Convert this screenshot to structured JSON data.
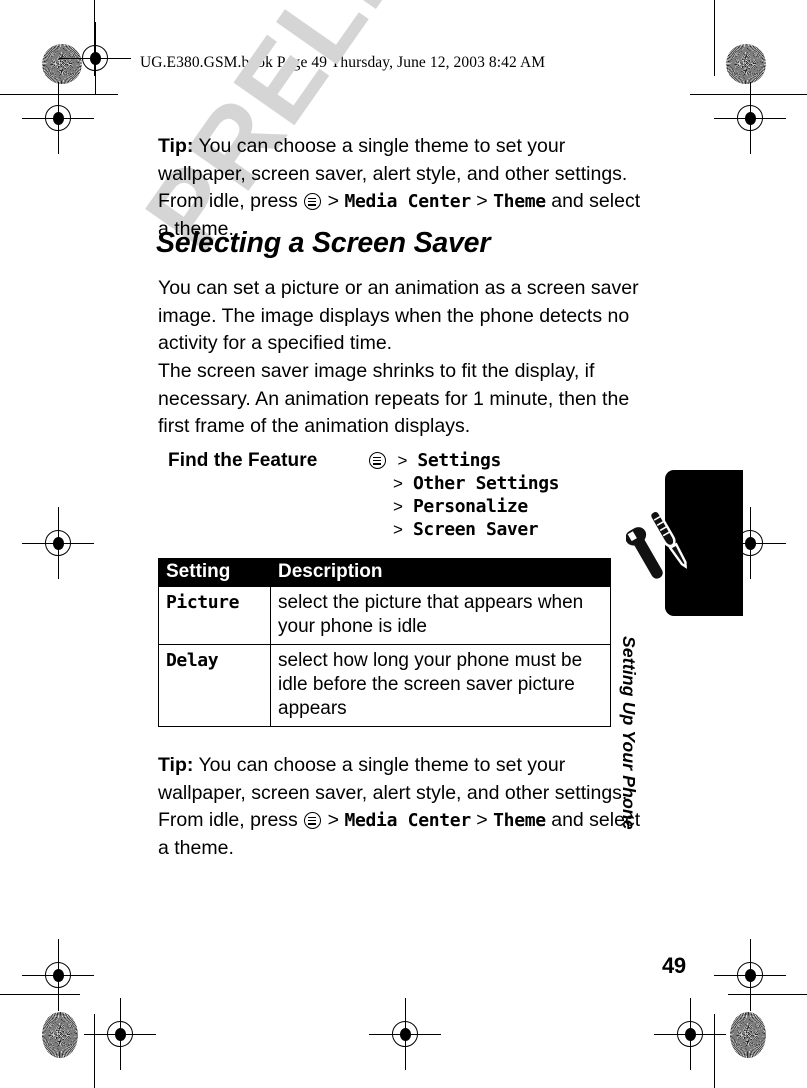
{
  "header": {
    "slug": "UG.E380.GSM.book  Page 49  Thursday, June 12, 2003  8:42 AM"
  },
  "watermark": {
    "text": "PRELIMINARY"
  },
  "main": {
    "tip_top": {
      "label": "Tip:",
      "text_1": " You can choose a single theme to set your wallpaper, screen saver, alert style, and other settings. From idle, press ",
      "menu_icon": "menu-icon",
      "sep_1": " > ",
      "menu_1": "Media Center",
      "sep_2": " > ",
      "menu_2": "Theme",
      "text_2": " and select a theme."
    },
    "heading": "Selecting a Screen Saver",
    "paragraph_1": "You can set a picture or an animation as a screen saver image. The image displays when the phone detects no activity for a specified time.",
    "paragraph_2": "The screen saver image shrinks to fit the display, if necessary. An animation repeats for 1 minute, then the first frame of the animation displays.",
    "find_the_feature": {
      "label": "Find the Feature",
      "menu_icon": "menu-icon",
      "steps": [
        {
          "sep": ">",
          "label": "Settings"
        },
        {
          "sep": ">",
          "label": "Other Settings"
        },
        {
          "sep": ">",
          "label": "Personalize"
        },
        {
          "sep": ">",
          "label": "Screen Saver"
        }
      ]
    },
    "table": {
      "headers": [
        "Setting",
        "Description"
      ],
      "rows": [
        {
          "setting": "Picture",
          "description": "select the picture that appears when your phone is idle"
        },
        {
          "setting": "Delay",
          "description": "select how long your phone must be idle before the screen saver picture appears"
        }
      ]
    },
    "tip_bottom": {
      "label": "Tip:",
      "text_1": " You can choose a single theme to set your wallpaper, screen saver, alert style, and other settings. From idle, press ",
      "menu_icon": "menu-icon",
      "sep_1": " > ",
      "menu_1": "Media Center",
      "sep_2": " > ",
      "menu_2": "Theme",
      "text_2": " and select a theme."
    }
  },
  "side_tab": {
    "title": "Setting Up Your Phone",
    "icon": "wrench-screwdriver-icon"
  },
  "footer": {
    "page_number": "49"
  },
  "colors": {
    "ink": "#000000",
    "paper": "#ffffff",
    "watermark": "#d5d5d5",
    "table_header_bg": "#000000",
    "table_header_text": "#ffffff"
  }
}
